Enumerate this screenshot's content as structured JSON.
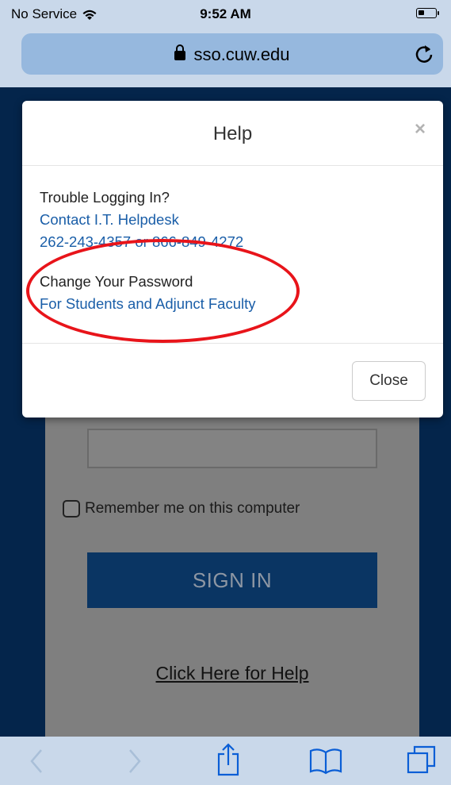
{
  "status_bar": {
    "carrier": "No Service",
    "time": "9:52 AM",
    "battery_level": 0.35
  },
  "browser": {
    "url": "sso.cuw.edu"
  },
  "login": {
    "remember_label": "Remember me on this computer",
    "signin_label": "SIGN IN",
    "help_link": "Click Here for Help"
  },
  "modal": {
    "title": "Help",
    "close_x": "×",
    "trouble_heading": "Trouble Logging In?",
    "helpdesk_link": "Contact I.T. Helpdesk",
    "phone_line": "262-243-4357 or 866-849-4272",
    "password_heading": "Change Your Password",
    "password_link": "For Students and Adjunct Faculty",
    "close_button": "Close"
  },
  "colors": {
    "page_background": "#04254b",
    "link": "#1a5ea8",
    "annotation": "#e8141a",
    "browser_chrome": "#c9d8ea"
  },
  "icons": [
    "wifi-icon",
    "lock-icon",
    "reload-icon",
    "back-icon",
    "forward-icon",
    "share-icon",
    "bookmarks-icon",
    "tabs-icon"
  ]
}
